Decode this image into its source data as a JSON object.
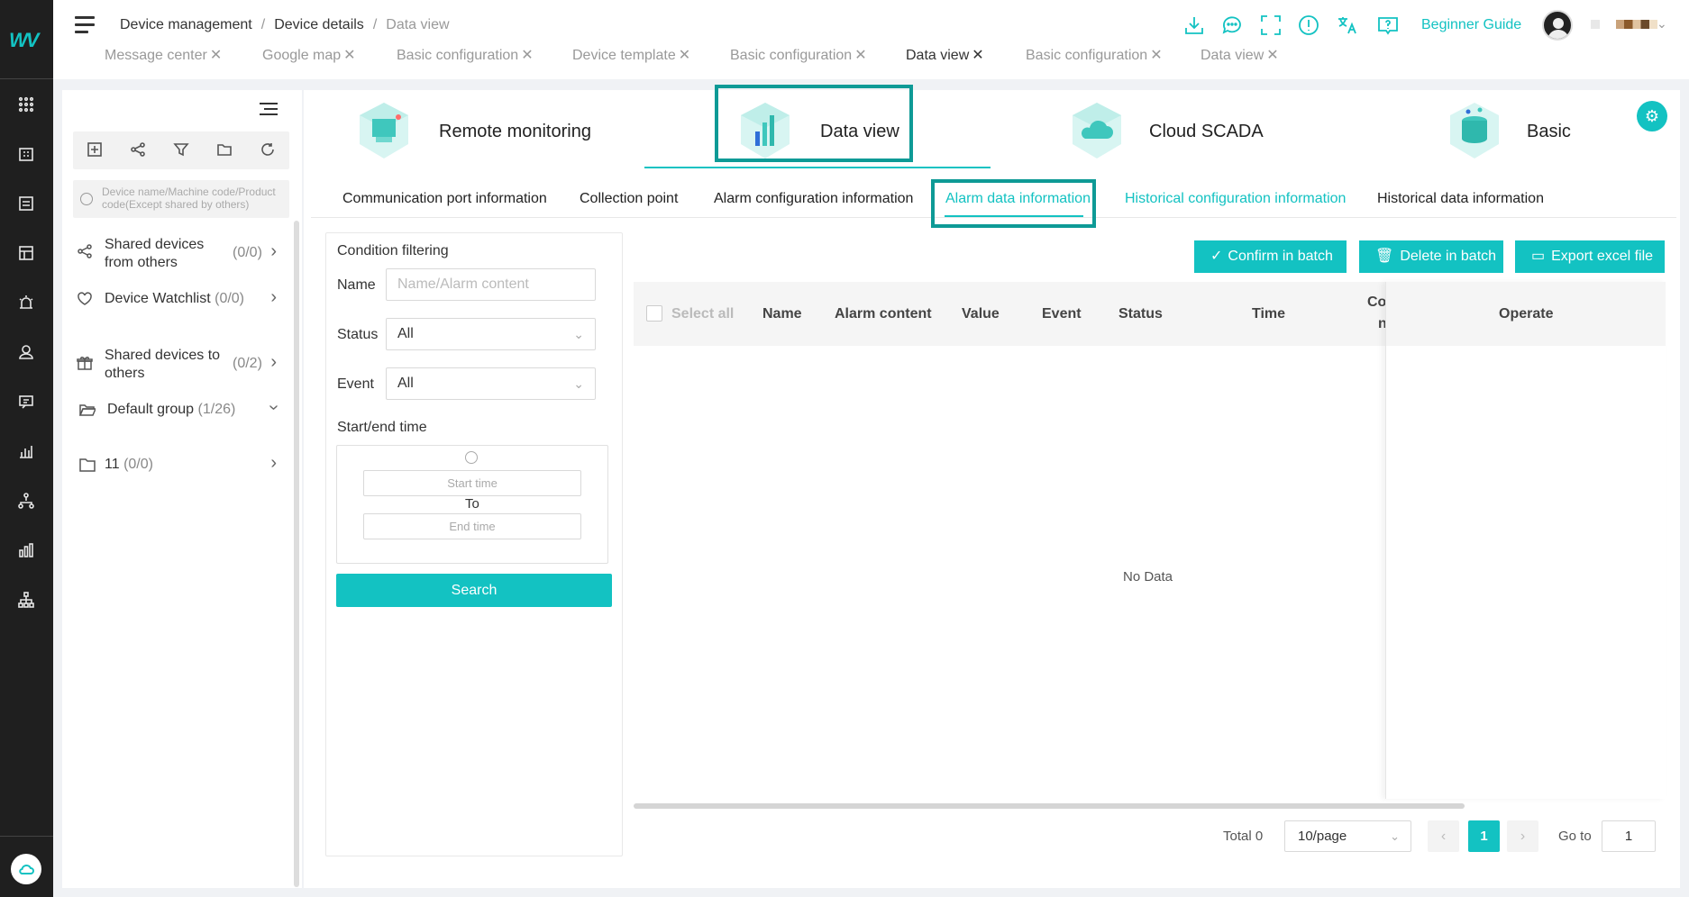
{
  "leftbar": {
    "logo": "W",
    "icons": [
      "grid-icon",
      "building-icon",
      "list-icon",
      "layout-icon",
      "alarm-icon",
      "user-icon",
      "message-icon",
      "chart-icon",
      "network-icon",
      "bar-chart-icon",
      "org-tree-icon"
    ],
    "bottom_icon": "cloud-icon"
  },
  "header": {
    "breadcrumb": [
      "Device management",
      "Device details",
      "Data view"
    ],
    "tabs": [
      {
        "label": "Message center",
        "active": false
      },
      {
        "label": "Google map",
        "active": false
      },
      {
        "label": "Basic configuration",
        "active": false
      },
      {
        "label": "Device template",
        "active": false
      },
      {
        "label": "Basic configuration",
        "active": false
      },
      {
        "label": "Data view",
        "active": true
      },
      {
        "label": "Basic configuration",
        "active": false
      },
      {
        "label": "Data view",
        "active": false
      }
    ],
    "icons": [
      "download-icon",
      "chat-icon",
      "fullscreen-icon",
      "info-icon",
      "translate-icon",
      "help-icon"
    ],
    "guide": "Beginner Guide"
  },
  "sidebar": {
    "search_placeholder": "Device name/Machine code/Product code(Except shared by others)",
    "groups": [
      {
        "label": "Shared devices from others",
        "count": "(0/0)"
      },
      {
        "label": "Device Watchlist",
        "count": "(0/0)"
      },
      {
        "label": "Shared devices to others",
        "count": "(0/2)"
      },
      {
        "label": "Default group",
        "count": "(1/26)"
      },
      {
        "label": "11",
        "count": "(0/0)"
      }
    ]
  },
  "module_tabs": [
    "Remote monitoring",
    "Data view",
    "Cloud SCADA",
    "Basic"
  ],
  "sub_tabs": [
    "Communication port information",
    "Collection point",
    "Alarm configuration information",
    "Alarm data information",
    "Historical configuration information",
    "Historical data information"
  ],
  "filter": {
    "title": "Condition filtering",
    "name_label": "Name",
    "name_placeholder": "Name/Alarm content",
    "status_label": "Status",
    "status_value": "All",
    "event_label": "Event",
    "event_value": "All",
    "time_label": "Start/end time",
    "start_placeholder": "Start time",
    "to": "To",
    "end_placeholder": "End time",
    "search": "Search"
  },
  "actions": {
    "confirm": "Confirm in batch",
    "delete": "Delete in batch",
    "export": "Export excel file"
  },
  "table": {
    "select_all": "Select all",
    "columns": [
      "Name",
      "Alarm content",
      "Value",
      "Event",
      "Status",
      "Time",
      "Co",
      "n",
      "Operate"
    ],
    "empty": "No Data"
  },
  "pagination": {
    "total": "Total 0",
    "page_size": "10/page",
    "current": "1",
    "goto_label": "Go to",
    "goto_value": "1",
    "prev": "‹",
    "next": "›"
  },
  "colors": {
    "accent": "#13c2c2",
    "highlight_box": "#0e9a96",
    "leftbar": "#1f1f1f"
  }
}
